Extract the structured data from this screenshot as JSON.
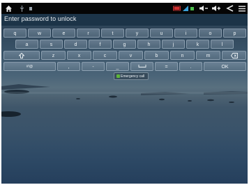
{
  "status_bar": {
    "icons": [
      "home-icon",
      "usb-icon",
      "notification-icon",
      "battery-icon",
      "wifi-icon",
      "volume-down-icon",
      "volume-up-icon",
      "back-icon",
      "menu-icon"
    ],
    "colors": {
      "background": "#050505",
      "battery": "#d03030",
      "wifi": "#3aa0d8"
    }
  },
  "lock": {
    "prompt": "Enter password to unlock"
  },
  "keyboard": {
    "rows": [
      [
        "q",
        "w",
        "e",
        "r",
        "t",
        "y",
        "u",
        "i",
        "o",
        "p"
      ],
      [
        "a",
        "s",
        "d",
        "f",
        "g",
        "h",
        "j",
        "k",
        "l"
      ],
      [
        "z",
        "x",
        "c",
        "v",
        "b",
        "n",
        "m"
      ]
    ],
    "row3_icons": {
      "left": "shift-icon",
      "right": "backspace-icon"
    },
    "row4": {
      "mode_key": "#!@",
      "keys": [
        ",",
        "-",
        "_",
        "=",
        "."
      ],
      "space_icon": "space-icon",
      "ok_key": "OK"
    },
    "colors": {
      "key_text": "#eef3f6",
      "pwbar": "#1c3448"
    }
  },
  "emergency_call": {
    "label": "Emergency call",
    "icon": "phone-icon"
  }
}
